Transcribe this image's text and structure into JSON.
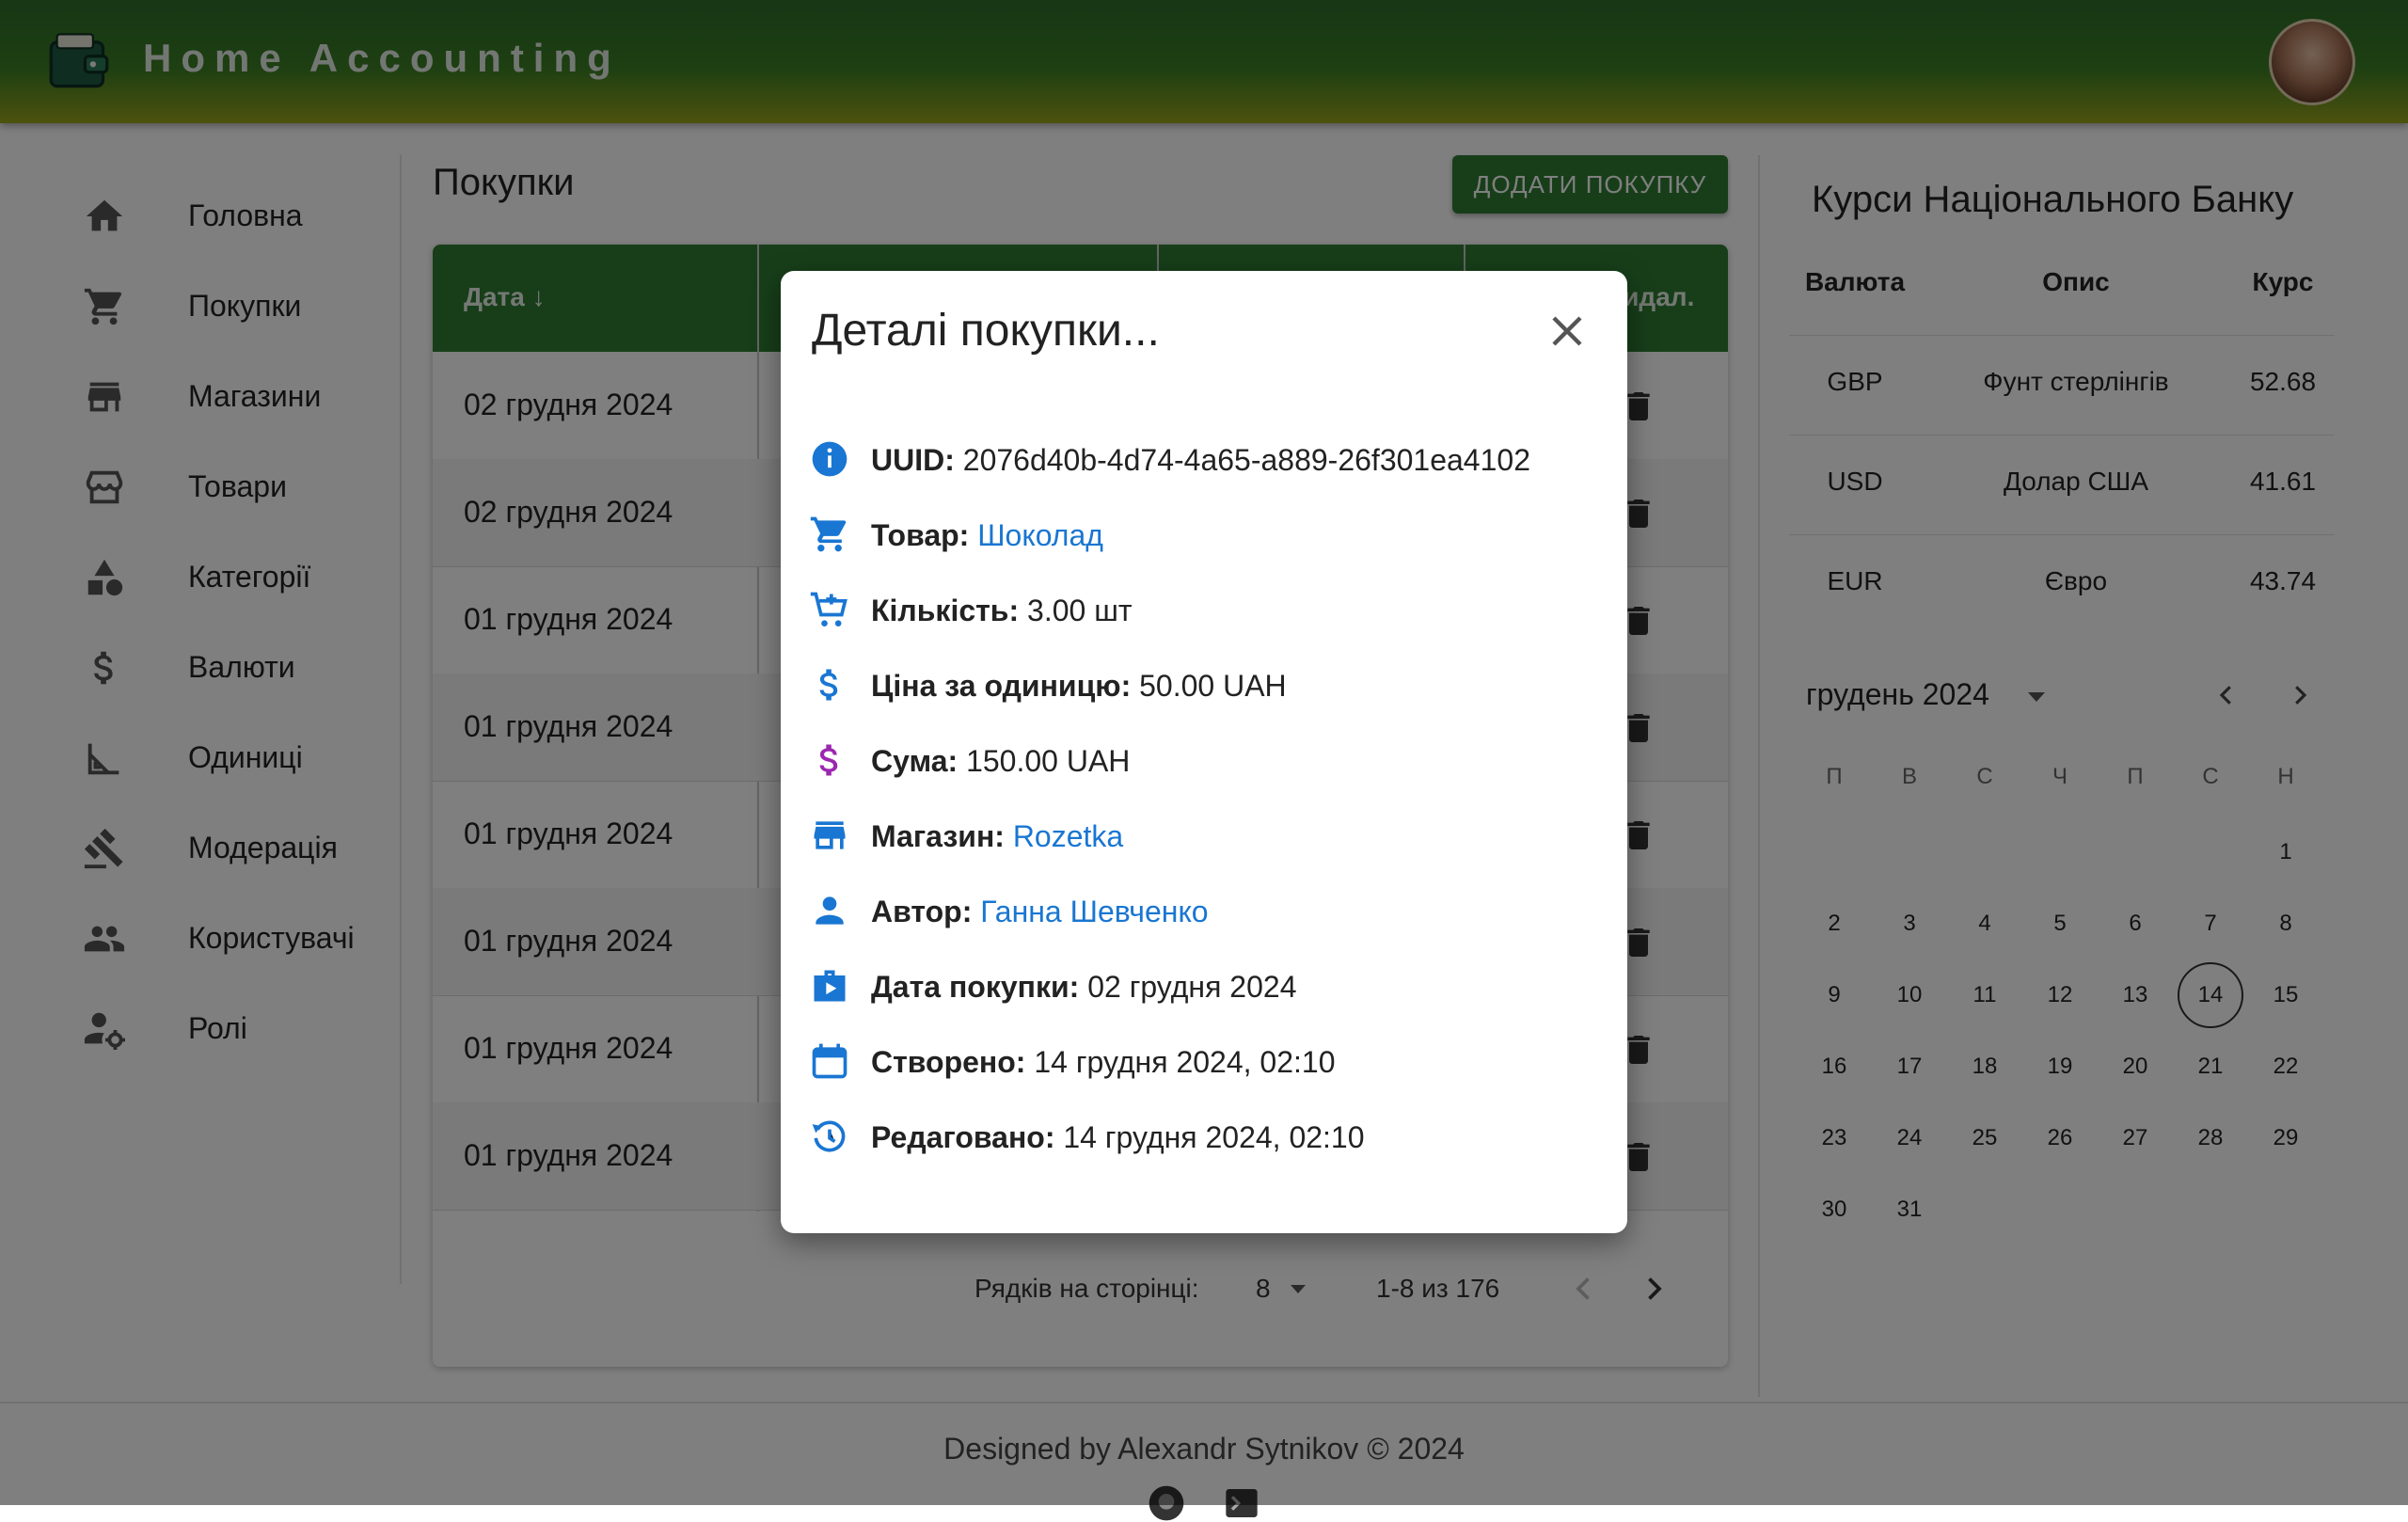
{
  "app": {
    "title": "Home Accounting"
  },
  "sidebar": {
    "items": [
      {
        "label": "Головна"
      },
      {
        "label": "Покупки"
      },
      {
        "label": "Магазини"
      },
      {
        "label": "Товари"
      },
      {
        "label": "Категорії"
      },
      {
        "label": "Валюти"
      },
      {
        "label": "Одиниці"
      },
      {
        "label": "Модерація"
      },
      {
        "label": "Користувачі"
      },
      {
        "label": "Ролі"
      }
    ]
  },
  "main": {
    "title": "Покупки",
    "add_button": "ДОДАТИ ПОКУПКУ",
    "columns": {
      "date": "Дата ↓",
      "delete": "Видал."
    },
    "rows": [
      {
        "date": "02 грудня 2024"
      },
      {
        "date": "02 грудня 2024"
      },
      {
        "date": "01 грудня 2024"
      },
      {
        "date": "01 грудня 2024"
      },
      {
        "date": "01 грудня 2024"
      },
      {
        "date": "01 грудня 2024"
      },
      {
        "date": "01 грудня 2024"
      },
      {
        "date": "01 грудня 2024"
      }
    ],
    "pagination": {
      "rows_per_page_label": "Рядків на сторінці:",
      "rows_per_page": "8",
      "range": "1-8 из 176"
    }
  },
  "rates": {
    "title": "Курси Національного Банку",
    "headers": {
      "currency": "Валюта",
      "description": "Опис",
      "rate": "Курс"
    },
    "rows": [
      {
        "currency": "GBP",
        "description": "Фунт стерлінгів",
        "rate": "52.68"
      },
      {
        "currency": "USD",
        "description": "Долар США",
        "rate": "41.61"
      },
      {
        "currency": "EUR",
        "description": "Євро",
        "rate": "43.74"
      }
    ]
  },
  "calendar": {
    "month": "грудень 2024",
    "weekdays": [
      "П",
      "В",
      "С",
      "Ч",
      "П",
      "С",
      "Н"
    ],
    "today": "14",
    "days": [
      "1",
      "2",
      "3",
      "4",
      "5",
      "6",
      "7",
      "8",
      "9",
      "10",
      "11",
      "12",
      "13",
      "14",
      "15",
      "16",
      "17",
      "18",
      "19",
      "20",
      "21",
      "22",
      "23",
      "24",
      "25",
      "26",
      "27",
      "28",
      "29",
      "30",
      "31"
    ]
  },
  "footer": {
    "text": "Designed by Alexandr Sytnikov © 2024"
  },
  "modal": {
    "title": "Деталі покупки...",
    "details": {
      "uuid_label": "UUID:",
      "uuid": "2076d40b-4d74-4a65-a889-26f301ea4102",
      "product_label": "Товар:",
      "product": "Шоколад",
      "quantity_label": "Кількість:",
      "quantity": "3.00 шт",
      "unit_price_label": "Ціна за одиницю:",
      "unit_price": "50.00 UAH",
      "sum_label": "Сума:",
      "sum": "150.00 UAH",
      "shop_label": "Магазин:",
      "shop": "Rozetka",
      "author_label": "Автор:",
      "author": "Ганна Шевченко",
      "purchase_date_label": "Дата покупки:",
      "purchase_date": "02 грудня 2024",
      "created_label": "Створено:",
      "created": "14 грудня 2024, 02:10",
      "edited_label": "Редаговано:",
      "edited": "14 грудня 2024, 02:10"
    }
  },
  "colors": {
    "primary": "#2e7d32",
    "link": "#1976d2",
    "sum_icon": "#9c27b0"
  }
}
